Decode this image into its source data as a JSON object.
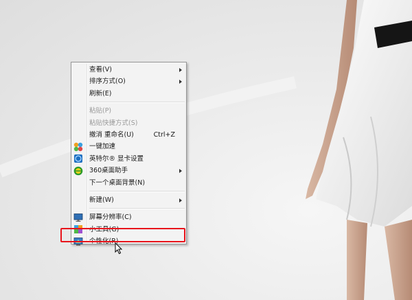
{
  "menu": {
    "items": [
      {
        "label": "查看(V)",
        "submenu": true
      },
      {
        "label": "排序方式(O)",
        "submenu": true
      },
      {
        "label": "刷新(E)"
      },
      {
        "label": "粘贴(P)",
        "disabled": true
      },
      {
        "label": "粘贴快捷方式(S)",
        "disabled": true
      },
      {
        "label": "撤消 重命名(U)",
        "shortcut": "Ctrl+Z"
      },
      {
        "label": "一键加速",
        "icon": "speedup-icon"
      },
      {
        "label": "英特尔® 显卡设置",
        "icon": "intel-graphics-icon"
      },
      {
        "label": "360桌面助手",
        "icon": "360-desktop-icon",
        "submenu": true
      },
      {
        "label": "下一个桌面背景(N)"
      },
      {
        "label": "新建(W)",
        "submenu": true
      },
      {
        "label": "屏幕分辨率(C)",
        "icon": "monitor-icon"
      },
      {
        "label": "小工具(G)",
        "icon": "gadgets-icon"
      },
      {
        "label": "个性化(R)",
        "icon": "personalize-icon"
      }
    ]
  },
  "colors": {
    "highlight_border": "#e8141b",
    "menu_bg": "#f3f3f3",
    "disabled_text": "#9a9a9a"
  }
}
